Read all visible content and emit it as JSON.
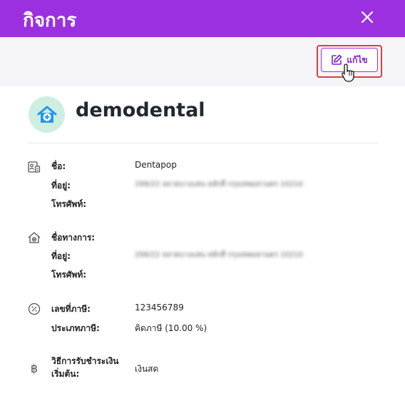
{
  "header": {
    "title": "กิจการ"
  },
  "toolbar": {
    "edit_label": "แก้ไข"
  },
  "profile": {
    "name": "demodental"
  },
  "contact": {
    "name_label": "ชื่อ:",
    "name_value": "Dentapop",
    "address_label": "ที่อยู่:",
    "address_value": "299/22 ลลาดบางแสน หลักสี่ กรุงเทพมหานคร 10210",
    "phone_label": "โทรศัพท์:"
  },
  "official": {
    "name_label": "ชื่อทางการ:",
    "address_label": "ที่อยู่:",
    "address_value": "299/22 ลลาดบางแสน หลักสี่ กรุงเทพมหานคร 10210",
    "phone_label": "โทรศัพท์:"
  },
  "tax": {
    "id_label": "เลขที่ภาษี:",
    "id_value": "123456789",
    "type_label": "ประเภทภาษี:",
    "type_value": "คิดภาษี (10.00 %)"
  },
  "payment": {
    "label_line1": "วิธีการรับชำระเงิน",
    "label_line2": "เริ่มต้น:",
    "value": "เงินสด"
  }
}
